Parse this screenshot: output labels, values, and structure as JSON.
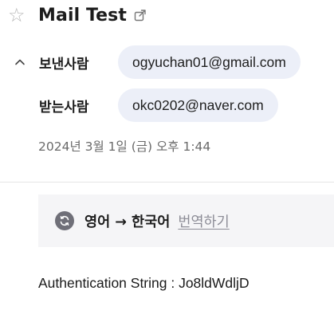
{
  "mail": {
    "subject": "Mail Test",
    "from_label": "보낸사람",
    "from_address": "ogyuchan01@gmail.com",
    "to_label": "받는사람",
    "to_address": "okc0202@naver.com",
    "date": "2024년 3월 1일 (금) 오후 1:44",
    "translate": {
      "direction": "영어 → 한국어",
      "link_label": "번역하기"
    },
    "body": "Authentication String : Jo8ldWdljD"
  },
  "icons": {
    "star": "star-outline-icon",
    "popout": "open-in-new-window-icon",
    "collapse": "chevron-up-icon",
    "translate": "translate-refresh-icon"
  },
  "colors": {
    "chip_background": "#eceff8",
    "translate_background": "#f5f5f7",
    "date_text": "#6a6a6a",
    "link_text": "#8c8c96"
  }
}
